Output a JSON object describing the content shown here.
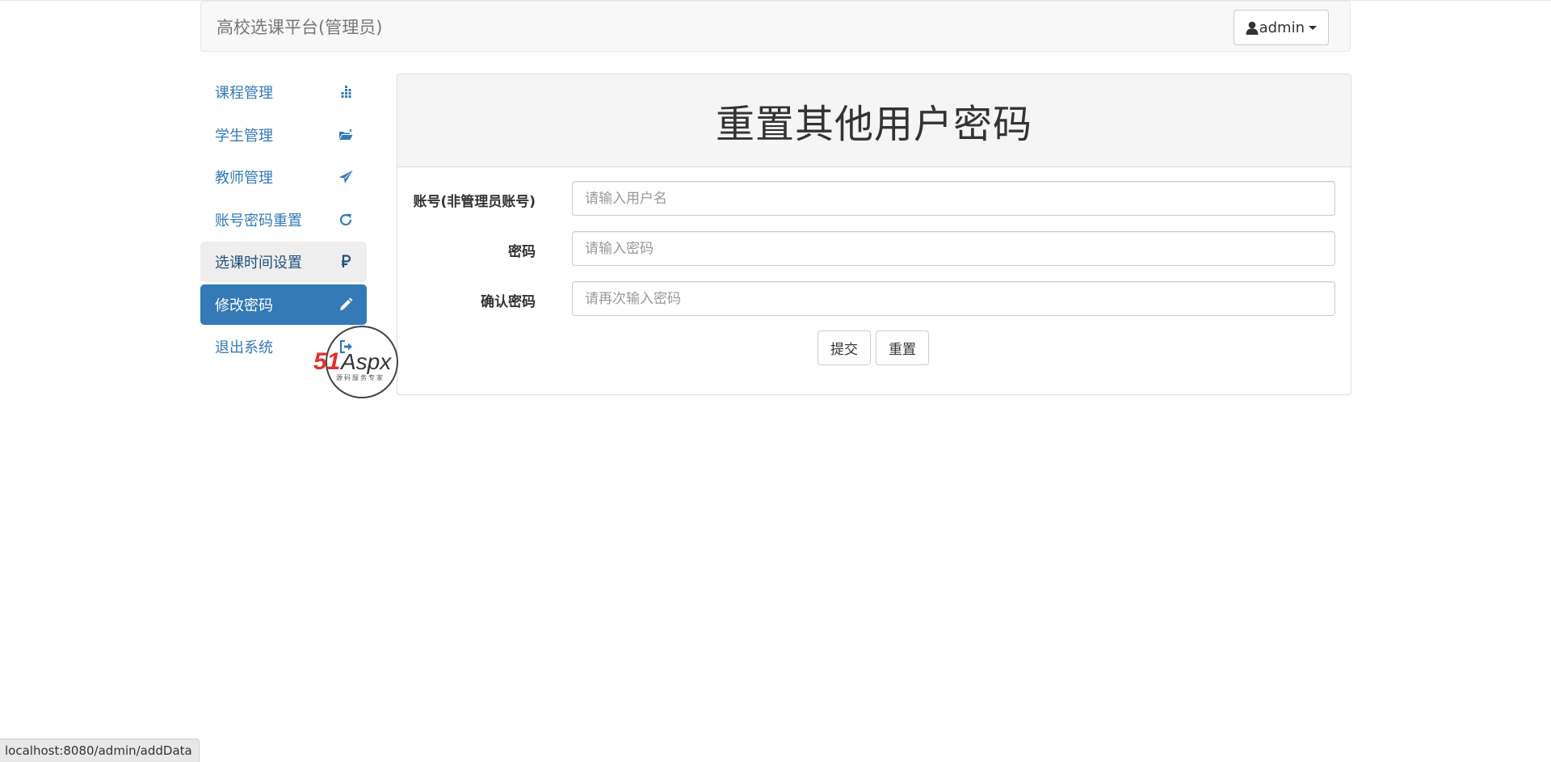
{
  "navbar": {
    "brand": "高校选课平台(管理员)",
    "user_label": "admin",
    "user_icon": "user-icon"
  },
  "sidebar": {
    "items": [
      {
        "label": "课程管理",
        "icon": "dashboard-icon",
        "state": "normal"
      },
      {
        "label": "学生管理",
        "icon": "folder-open-icon",
        "state": "normal"
      },
      {
        "label": "教师管理",
        "icon": "send-icon",
        "state": "normal"
      },
      {
        "label": "账号密码重置",
        "icon": "refresh-icon",
        "state": "normal"
      },
      {
        "label": "选课时间设置",
        "icon": "ruble-icon",
        "state": "hover"
      },
      {
        "label": "修改密码",
        "icon": "pencil-icon",
        "state": "active"
      },
      {
        "label": "退出系统",
        "icon": "logout-icon",
        "state": "normal"
      }
    ]
  },
  "panel": {
    "title": "重置其他用户密码",
    "fields": [
      {
        "label": "账号(非管理员账号)",
        "placeholder": "请输入用户名",
        "value": ""
      },
      {
        "label": "密码",
        "placeholder": "请输入密码",
        "value": ""
      },
      {
        "label": "确认密码",
        "placeholder": "请再次输入密码",
        "value": ""
      }
    ],
    "submit_label": "提交",
    "reset_label": "重置"
  },
  "watermark": {
    "text_main": "51Aspx",
    "text_sub": "源码服务专家"
  },
  "statusbar": {
    "url": "localhost:8080/admin/addData"
  },
  "colors": {
    "primary": "#337ab7",
    "navbar_bg": "#f8f8f8",
    "panel_head_bg": "#f5f5f5",
    "watermark_red": "#e0322d",
    "watermark_green": "#3aa935"
  }
}
